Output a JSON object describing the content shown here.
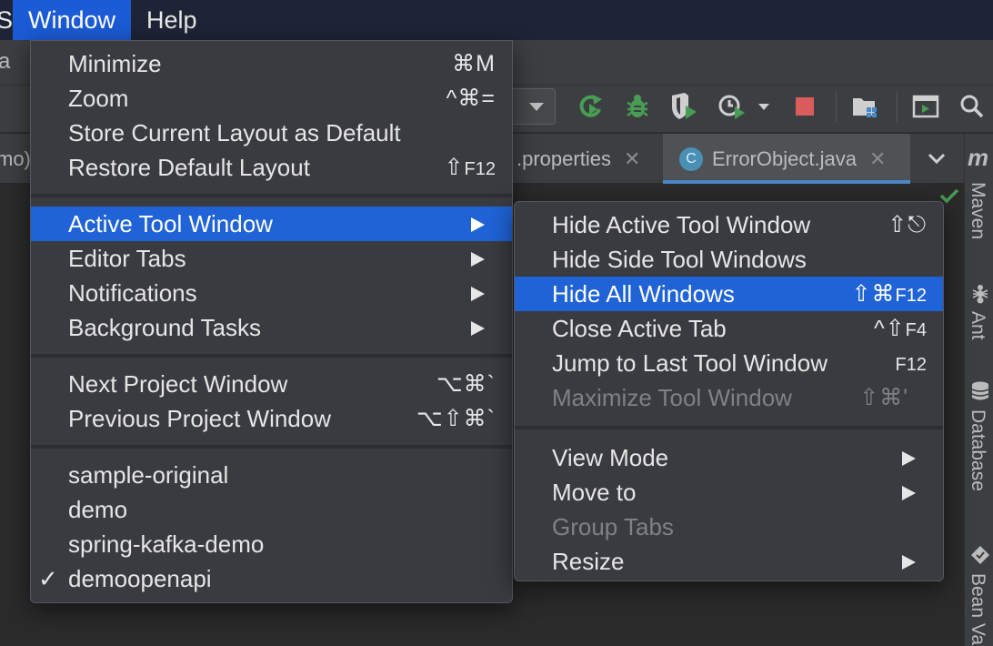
{
  "menubar": {
    "items": [
      {
        "label": "S",
        "cut": true,
        "active": false
      },
      {
        "label": "Window",
        "active": true
      },
      {
        "label": "Help",
        "active": false
      }
    ]
  },
  "titlebar": {
    "fragment": "a"
  },
  "editor_tabs": [
    {
      "label": "mo)",
      "closable": false,
      "active": false
    },
    {
      "label": ".properties",
      "closable": true,
      "active": false
    },
    {
      "label": "ErrorObject.java",
      "closable": true,
      "active": true,
      "icon_letter": "C"
    }
  ],
  "close_glyph": "✕",
  "right_strip": {
    "logo": "m",
    "items": [
      {
        "label": "Maven",
        "icon": null
      },
      {
        "label": "Ant",
        "icon": "ant-icon"
      },
      {
        "label": "Database",
        "icon": "database-icon"
      },
      {
        "label": "Bean Va",
        "icon": "bean-icon"
      }
    ]
  },
  "window_menu": {
    "groups": [
      [
        {
          "label": "Minimize",
          "shortcut": "⌘M"
        },
        {
          "label": "Zoom",
          "shortcut": "^⌘="
        },
        {
          "label": "Store Current Layout as Default",
          "shortcut": ""
        },
        {
          "label": "Restore Default Layout",
          "shortcut": "⇧",
          "shortcut_key": "F12"
        }
      ],
      [
        {
          "label": "Active Tool Window",
          "submenu": true,
          "highlighted": true
        },
        {
          "label": "Editor Tabs",
          "submenu": true
        },
        {
          "label": "Notifications",
          "submenu": true
        },
        {
          "label": "Background Tasks",
          "submenu": true
        }
      ],
      [
        {
          "label": "Next Project Window",
          "shortcut": "⌥⌘`"
        },
        {
          "label": "Previous Project Window",
          "shortcut": "⌥⇧⌘`"
        }
      ],
      [
        {
          "label": "sample-original"
        },
        {
          "label": "demo"
        },
        {
          "label": "spring-kafka-demo"
        },
        {
          "label": "demoopenapi",
          "checked": true
        }
      ]
    ]
  },
  "active_tool_window_submenu": {
    "groups": [
      [
        {
          "label": "Hide Active Tool Window",
          "shortcut": "⇧⎋"
        },
        {
          "label": "Hide Side Tool Windows",
          "shortcut": ""
        },
        {
          "label": "Hide All Windows",
          "shortcut": "⇧⌘",
          "shortcut_key": "F12",
          "highlighted": true
        },
        {
          "label": "Close Active Tab",
          "shortcut": "^⇧",
          "shortcut_key": "F4"
        },
        {
          "label": "Jump to Last Tool Window",
          "shortcut": "",
          "shortcut_key": "F12"
        },
        {
          "label": "Maximize Tool Window",
          "shortcut": "⇧⌘'",
          "disabled": true
        }
      ],
      [
        {
          "label": "View Mode",
          "submenu": true
        },
        {
          "label": "Move to",
          "submenu": true
        },
        {
          "label": "Group Tabs",
          "disabled": true
        },
        {
          "label": "Resize",
          "submenu": true
        }
      ]
    ]
  },
  "colors": {
    "menubar_bg": "#1e2436",
    "selection": "#1f63d6",
    "menu_bg": "#393b40",
    "run_green": "#499c54",
    "stop_red": "#db5c5c"
  }
}
